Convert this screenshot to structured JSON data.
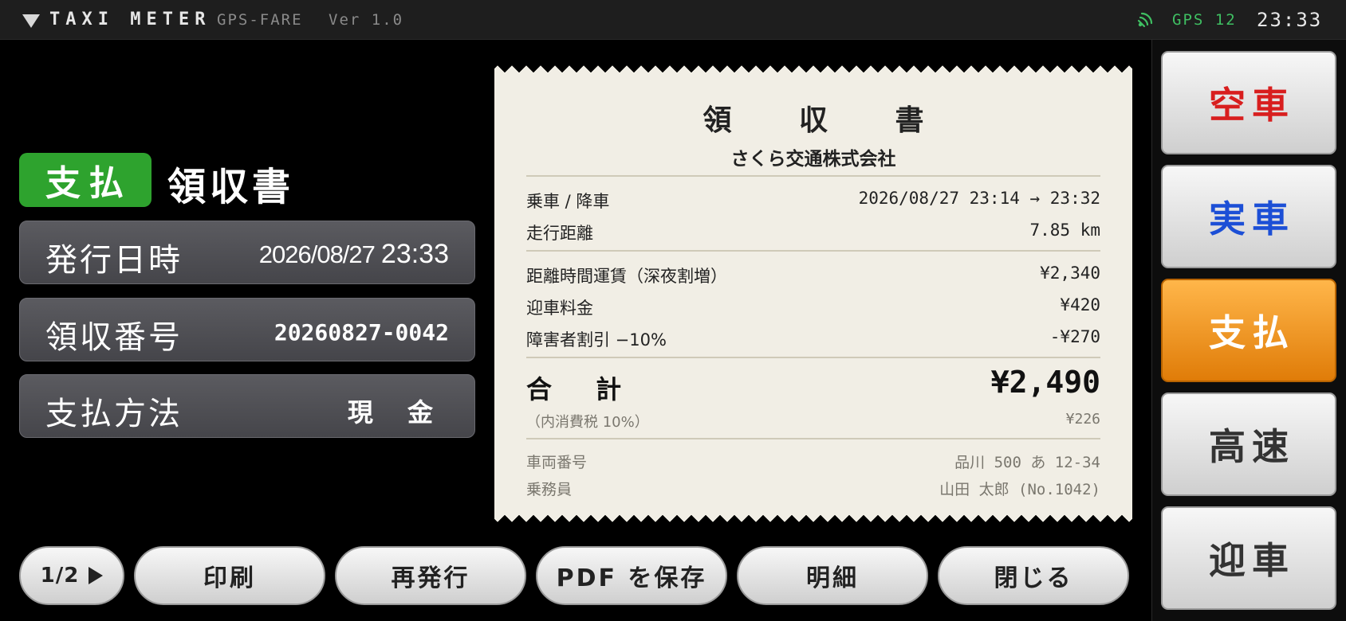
{
  "topbar": {
    "title": "TAXI METER",
    "subtitle": "GPS-FARE",
    "version": "Ver 1.0",
    "gps_label": "GPS 12",
    "gps_icon": "gps-signal-icon",
    "time": "23:33",
    "menu_icon": "triangle-down-icon",
    "gps_color": "#3fbf62"
  },
  "panel": {
    "badge": "支払",
    "heading": "領収書",
    "rows": [
      {
        "label": "発行日時",
        "date": "2026/08/27",
        "time": "23:33"
      },
      {
        "label": "領収番号",
        "value": "20260827-0042"
      },
      {
        "label": "支払方法",
        "value": "現 金"
      }
    ]
  },
  "receipt": {
    "title": "領 収 書",
    "company": "さくら交通株式会社",
    "trip": [
      {
        "label": "乗車 / 降車",
        "value": "2026/08/27 23:14 → 23:32"
      },
      {
        "label": "走行距離",
        "value": "7.85 km"
      }
    ],
    "items": [
      {
        "label": "距離時間運賃（深夜割増）",
        "value": "¥2,340"
      },
      {
        "label": "迎車料金",
        "value": "¥420"
      },
      {
        "label": "障害者割引 −10%",
        "value": "-¥270"
      }
    ],
    "total_label": "合 計",
    "total_value": "¥2,490",
    "tax_label": "（内消費税 10%）",
    "tax_value": "¥226",
    "footer": [
      {
        "label": "車両番号",
        "value": "品川 500 あ 12-34"
      },
      {
        "label": "乗務員",
        "value": "山田 太郎 (No.1042)"
      }
    ]
  },
  "modes": [
    {
      "label": "空車",
      "color": "#d81e1e",
      "active": false
    },
    {
      "label": "実車",
      "color": "#1c4fd6",
      "active": false
    },
    {
      "label": "支払",
      "color": "#ffffff",
      "active": true
    },
    {
      "label": "高速",
      "color": "#333333",
      "active": false
    },
    {
      "label": "迎車",
      "color": "#333333",
      "active": false
    }
  ],
  "actions": {
    "page": "1/2",
    "page_icon": "play-arrow-icon",
    "print": "印刷",
    "reissue": "再発行",
    "save_pdf": "PDF を保存",
    "details": "明細",
    "close": "閉じる"
  }
}
